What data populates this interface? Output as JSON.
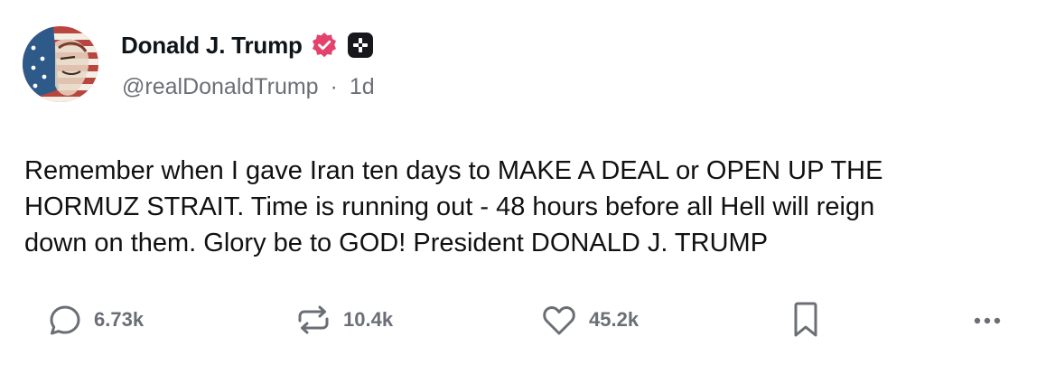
{
  "author": {
    "display_name": "Donald J. Trump",
    "handle": "@realDonaldTrump",
    "separator": "·",
    "time_ago": "1d",
    "verified_badge_color": "#e0245e"
  },
  "post": {
    "text": "Remember when I gave Iran ten days to MAKE A DEAL or OPEN UP THE\nHORMUZ STRAIT. Time is running out - 48 hours before all Hell will reign\ndown on them. Glory be to GOD! President DONALD J. TRUMP"
  },
  "actions": {
    "replies": "6.73k",
    "reposts": "10.4k",
    "likes": "45.2k"
  },
  "icons": [
    "verified-badge-icon",
    "plus-badge-icon",
    "reply-icon",
    "repost-icon",
    "like-icon",
    "bookmark-icon",
    "more-icon"
  ]
}
